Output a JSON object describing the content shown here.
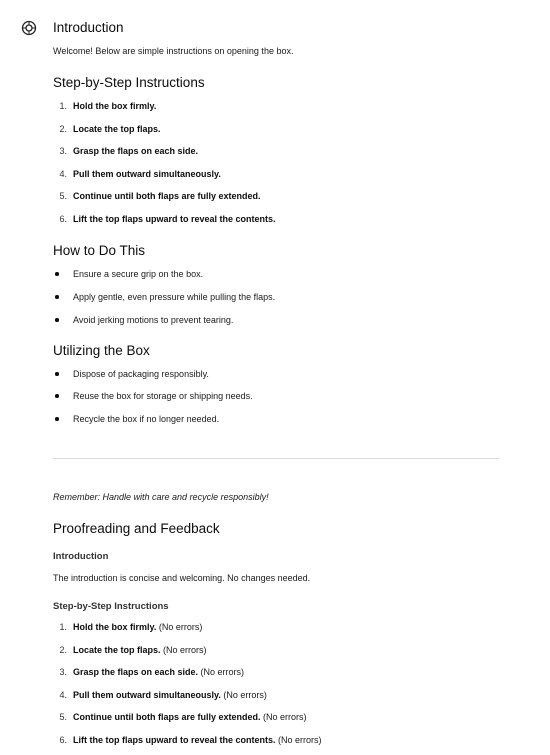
{
  "icons": {
    "assistant": "openai-logo-icon"
  },
  "sections": {
    "intro": {
      "heading": "Introduction",
      "text": "Welcome! Below are simple instructions on opening the box."
    },
    "steps": {
      "heading": "Step-by-Step Instructions",
      "items": [
        "Hold the box firmly.",
        "Locate the top flaps.",
        "Grasp the flaps on each side.",
        "Pull them outward simultaneously.",
        "Continue until both flaps are fully extended.",
        "Lift the top flaps upward to reveal the contents."
      ]
    },
    "howto": {
      "heading": "How to Do This",
      "items": [
        "Ensure a secure grip on the box.",
        "Apply gentle, even pressure while pulling the flaps.",
        "Avoid jerking motions to prevent tearing."
      ]
    },
    "utilize": {
      "heading": "Utilizing the Box",
      "items": [
        "Dispose of packaging responsibly.",
        "Reuse the box for storage or shipping needs.",
        "Recycle the box if no longer needed."
      ]
    },
    "remember": "Remember: Handle with care and recycle responsibly!",
    "proof": {
      "heading": "Proofreading and Feedback",
      "intro_label": "Introduction",
      "intro_text": "The introduction is concise and welcoming. No changes needed.",
      "steps_label": "Step-by-Step Instructions",
      "suffix": " (No errors)",
      "items": [
        "Hold the box firmly.",
        "Locate the top flaps.",
        "Grasp the flaps on each side.",
        "Pull them outward simultaneously.",
        "Continue until both flaps are fully extended.",
        "Lift the top flaps upward to reveal the contents."
      ]
    }
  }
}
